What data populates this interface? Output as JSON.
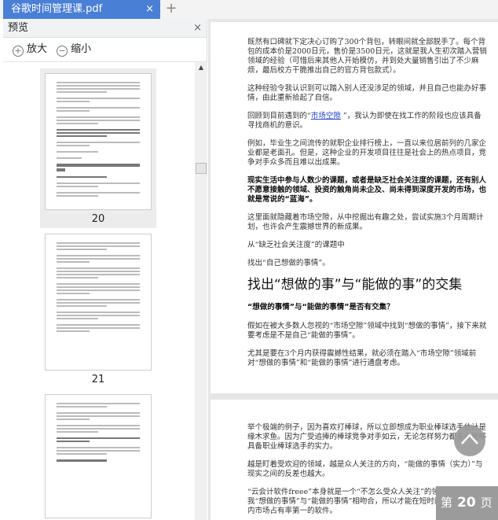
{
  "tab": {
    "title": "谷歌时间管理课.pdf",
    "close": "×",
    "new": "+"
  },
  "sidebar": {
    "title": "预览",
    "close": "×",
    "zoom_in": "放大",
    "zoom_out": "缩小",
    "pages": [
      "20",
      "21"
    ]
  },
  "document": {
    "p1": "既然有口碑就下定决心订购了300个背包，转眼间就全部脱手了。每个背包的成本价是2000日元，售价是3500日元，这就是我人生初次踏入营销领域的经验（可惜后来其他人开始模仿，并到处大量销售引出了不少麻烦，最后校方干脆推出自己的官方背包款式）。",
    "p2": "这种经验令我认识到可以踏入别人还没涉足的领域，并且自己也能办好事情，由此重新拾起了自信。",
    "p3a": "回顾到目前遇到的“",
    "p3link": "市场空隙",
    "p3b": " ”，我认为即使在找工作的阶段也应该具备寻找商机的意识。",
    "p4": "例如，毕业生之间流传的就职企业排行榜上，一直以来位居前列的几家企业都是老面孔。但是，这种企业的开发项目往往是社会上的热点项目，竞争对手众多而且难以出成果。",
    "p5": "现实生活中参与人数少的课题，或者是缺乏社会关注度的课题，还有别人不愿意接触的领域、投资的触角尚未企及、尚未得到深度开发的市场，也就是常说的“蓝海”。",
    "p6": "这里面就隐藏着市场空隙，从中挖掘出有趣之处，尝试实施3个月周期计划，也许会产生震撼世界的新成果。",
    "p7": "从“缺乏社会关注度”的课题中",
    "p8": "找出“自己想做的事情”。",
    "h1": "找出“想做的事”与“能做的事”的交集",
    "h3": "“想做的事情”与“能做的事情”是否有交集？",
    "p9": "假如在被大多数人忽视的“市场空隙”领域中找到“想做的事情”，接下来就要考虑是不是自己“能做的事情”。",
    "p10": "尤其是要在3个月内获得震撼性结果，就必须在踏入“市场空隙”领域前对“想做的事情”和“能做的事情”进行通盘考虑。",
    "q1": "举个极端的例子，因为喜欢打棒球，所以立即想成为职业棒球选手估计是缘木求鱼。因为广受追捧的棒球竞争对手如云，无论怎样努力都未必能够具备职业棒球选手的实力。",
    "q2": "越是盯着受欢迎的领域，越是众人关注的方向，“能做的事情（实力）”与现实之间的反差也越大。",
    "q3": "“云会计软件freee”本身就是一个“不怎么受众人关注”的领域，正是因为我“想做的事情”与“能做的事情”相吻合，所以才能在短时间内成为日本国内市场占有率第一的软件。"
  },
  "page_indicator": {
    "prefix": "第",
    "number": "20",
    "suffix": "页"
  }
}
